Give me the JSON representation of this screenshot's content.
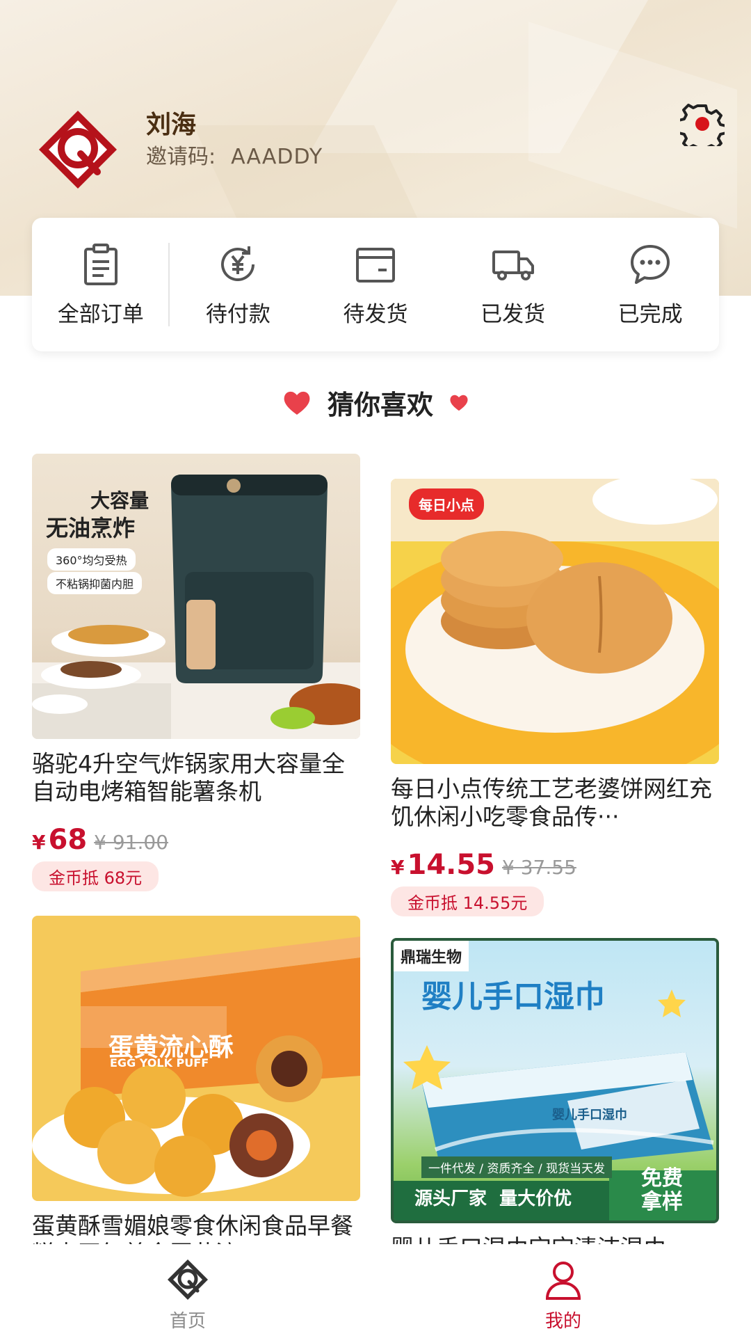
{
  "profile": {
    "name": "刘海",
    "invite_label": "邀请码:",
    "invite_code": "AAADDY"
  },
  "orders": [
    {
      "label": "全部订单",
      "icon": "clipboard-icon"
    },
    {
      "label": "待付款",
      "icon": "yen-refresh-icon"
    },
    {
      "label": "待发货",
      "icon": "wallet-box-icon"
    },
    {
      "label": "已发货",
      "icon": "truck-icon"
    },
    {
      "label": "已完成",
      "icon": "chat-bubble-icon"
    }
  ],
  "section": {
    "title": "猜你喜欢"
  },
  "products": [
    {
      "name": "骆驼4升空气炸锅家用大容量全自动电烤箱智能薯条机",
      "yen": "¥",
      "price": "68",
      "old_price": "¥ 91.00",
      "coin": "金币抵 68元",
      "image_text": {
        "line1": "大容量",
        "line2": "无油烹炸",
        "tag1": "360°均匀受热",
        "tag2": "不粘锅抑菌内胆"
      }
    },
    {
      "name": "每日小点传统工艺老婆饼网红充饥休闲小吃零食品传···",
      "yen": "¥",
      "price": "14.55",
      "old_price": "¥ 37.55",
      "coin": "金币抵 14.55元",
      "image_text": {
        "brand": "每日小点"
      }
    },
    {
      "name": "蛋黄酥雪媚娘零食休闲食品早餐糕点网红美食蛋黄流",
      "image_text": {
        "box": "蛋黄流心酥",
        "box_en": "EGG YOLK PUFF"
      }
    },
    {
      "name": "婴儿手口湿巾宝宝清洁湿巾",
      "image_text": {
        "brand": "鼎瑞生物",
        "title": "婴儿手口湿巾",
        "strip": "一件代发 / 资质齐全 / 现货当天发",
        "bottom": "源头厂家  量大价优",
        "free1": "免费",
        "free2": "拿样",
        "pack": "婴儿手口湿巾"
      }
    }
  ],
  "nav": [
    {
      "label": "首页",
      "icon": "home-logo-icon",
      "active": false
    },
    {
      "label": "我的",
      "icon": "person-icon",
      "active": true
    }
  ],
  "colors": {
    "accent": "#c8102e",
    "header_bg": "#f1e6d4",
    "brand_red": "#b5121b"
  }
}
